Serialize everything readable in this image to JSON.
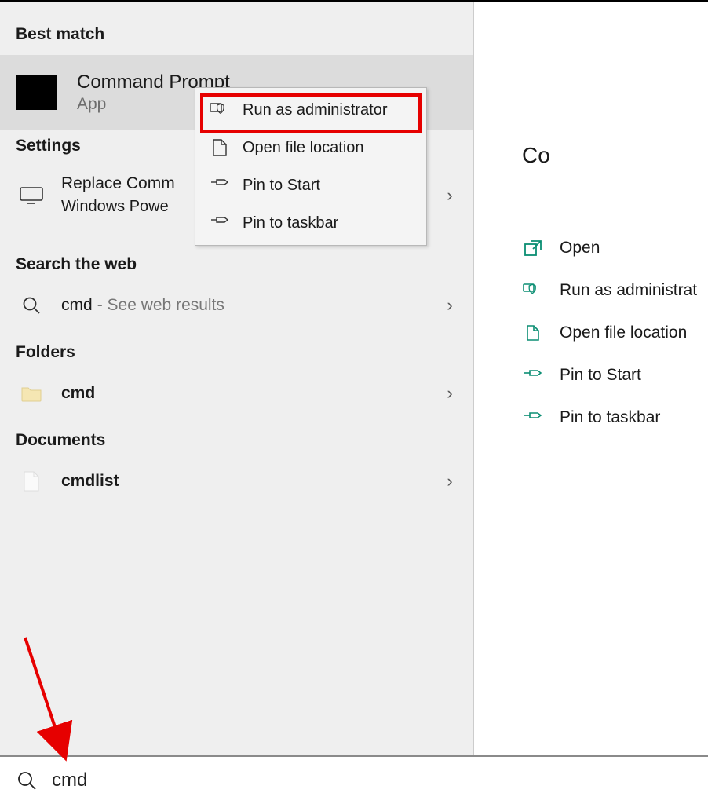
{
  "left": {
    "best_match_header": "Best match",
    "best_match_title": "Command Prompt",
    "best_match_sub": "App",
    "settings_header": "Settings",
    "settings_item_line1": "Replace Comm",
    "settings_item_line2": "Windows Powe",
    "web_header": "Search the web",
    "web_item_primary": "cmd",
    "web_item_secondary": "- See web results",
    "folders_header": "Folders",
    "folders_item": "cmd",
    "documents_header": "Documents",
    "documents_item": "cmdlist"
  },
  "context_menu": {
    "run_admin": "Run as administrator",
    "open_file_location": "Open file location",
    "pin_start": "Pin to Start",
    "pin_taskbar": "Pin to taskbar"
  },
  "right": {
    "title": "Co",
    "actions": {
      "open": "Open",
      "run_admin": "Run as administrat",
      "open_file_location": "Open file location",
      "pin_start": "Pin to Start",
      "pin_taskbar": "Pin to taskbar"
    }
  },
  "search": {
    "query": "cmd"
  },
  "colors": {
    "accent_teal": "#0b8e73",
    "highlight_red": "#e60000"
  }
}
